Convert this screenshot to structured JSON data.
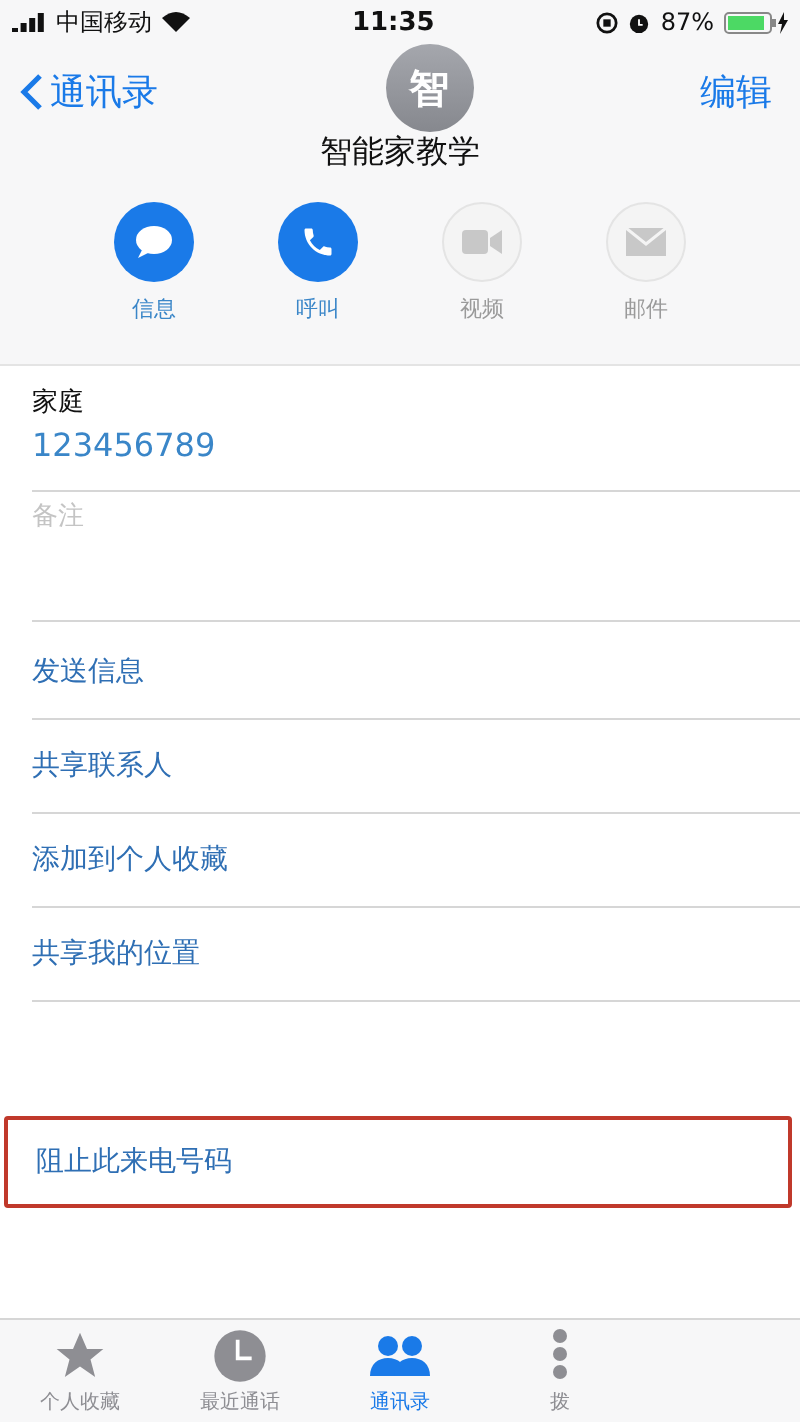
{
  "status_bar": {
    "carrier": "中国移动",
    "time": "11:35",
    "battery": "87%"
  },
  "nav": {
    "back": "通讯录",
    "edit": "编辑"
  },
  "contact": {
    "initial": "智",
    "name": "智能家教学"
  },
  "actions": [
    {
      "label": "信息",
      "kind": "message",
      "disabled": false
    },
    {
      "label": "呼叫",
      "kind": "call",
      "disabled": false
    },
    {
      "label": "视频",
      "kind": "video",
      "disabled": true
    },
    {
      "label": "邮件",
      "kind": "mail",
      "disabled": true
    }
  ],
  "phone": {
    "label": "家庭",
    "number": "123456789"
  },
  "notes": {
    "placeholder": "备注"
  },
  "links": [
    {
      "label": "发送信息"
    },
    {
      "label": "共享联系人"
    },
    {
      "label": "添加到个人收藏"
    },
    {
      "label": "共享我的位置"
    }
  ],
  "block": {
    "label": "阻止此来电号码",
    "highlighted": true
  },
  "tabs": [
    {
      "label": "个人收藏",
      "kind": "star",
      "selected": false
    },
    {
      "label": "最近通话",
      "kind": "clock",
      "selected": false
    },
    {
      "label": "通讯录",
      "kind": "contacts",
      "selected": true
    },
    {
      "label": "拨",
      "kind": "keypad",
      "selected": false
    }
  ]
}
